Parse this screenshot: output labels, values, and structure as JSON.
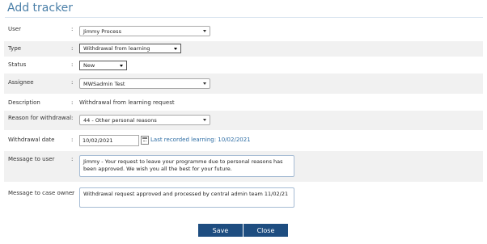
{
  "page": {
    "title": "Add tracker"
  },
  "colon": ":",
  "form": {
    "user": {
      "label": "User",
      "value": "Jimmy Process"
    },
    "type": {
      "label": "Type",
      "value": "Withdrawal from learning"
    },
    "status": {
      "label": "Status",
      "value": "New"
    },
    "assignee": {
      "label": "Assignee",
      "value": "MWSadmin Test"
    },
    "description": {
      "label": "Description",
      "value": "Withdrawal from learning request"
    },
    "reason": {
      "label": "Reason for withdrawal",
      "value": "44 - Other personal reasons"
    },
    "withdrawal_date": {
      "label": "Withdrawal date",
      "value": "10/02/2021",
      "last_recorded": "Last recorded learning: 10/02/2021"
    },
    "message_user": {
      "label": "Message to user",
      "value": "Jimmy - Your request to leave your programme due to personal reasons has been approved. We wish you all the best for your future."
    },
    "message_owner": {
      "label": "Message to case owner",
      "value": "Withdrawal request approved and processed by central admin team 11/02/21"
    }
  },
  "buttons": {
    "save": "Save",
    "close": "Close"
  },
  "colors": {
    "title": "#4a7fa8",
    "button": "#1e4d80",
    "link": "#2e6da4",
    "shade": "#f1f1f1"
  }
}
